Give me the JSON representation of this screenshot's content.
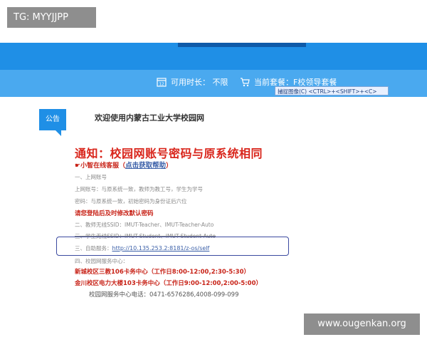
{
  "watermark": {
    "top_left": "TG: MYYJJPP",
    "bottom_right": "www.ougenkan.org"
  },
  "info_bar": {
    "duration": "可用时长：  不限",
    "package": "当前套餐：F校领导套餐",
    "capture_tip": "捕捉图像(C)   <CTRL>+<SHIFT>+<C>"
  },
  "notice": {
    "badge": "公告",
    "welcome": "欢迎使用内蒙古工业大学校园网",
    "title": "通知：校园网账号密码与原系统相同",
    "online_service_prefix": "☛小智在线客服（",
    "online_service_link": "点击获取帮助",
    "online_service_suffix": "）",
    "lines": {
      "l1": "一、上网账号",
      "l2": "上网账号：与原系统一致，教师为教工号，学生为学号",
      "l3": "密码：与原系统一致，初始密码为身份证后六位",
      "l4": "请您登陆后及时修改默认密码",
      "l5": "二、教师无线SSID：IMUT-Teacher、IMUT-Teacher-Auto",
      "l6": "三、学生无线SSID：IMUT-Student、IMUT-Student-Auto",
      "l7_prefix": "三、自助服务：",
      "l7_link": "http://10.135.253.2:8181/z-os/self",
      "l8": "四、校园网服务中心：",
      "l9": "新城校区三教106卡务中心（工作日8:00-12:00,2:30-5:30）",
      "l10": "金川校区电力大楼103卡务中心（工作日9:00-12:00,2:00-5:00）",
      "l11": "校园网服务中心电话：0471-6576286,4008-099-099"
    }
  },
  "colors": {
    "primary_blue": "#1f8fe6",
    "info_blue": "#4aa9ef",
    "notice_red": "#d9261c",
    "highlight_box": "#3b4aa0"
  },
  "icons": [
    "clock-icon",
    "cart-icon"
  ]
}
